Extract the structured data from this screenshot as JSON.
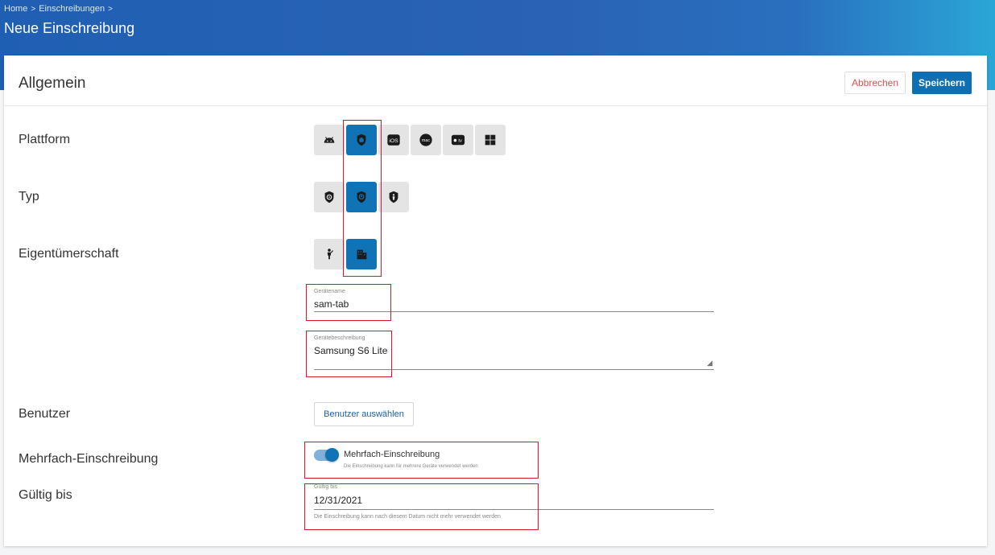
{
  "breadcrumb": {
    "home": "Home",
    "enrollments": "Einschreibungen",
    "separator": ">"
  },
  "page_title": "Neue Einschreibung",
  "card": {
    "title": "Allgemein",
    "cancel_label": "Abbrechen",
    "save_label": "Speichern"
  },
  "platform": {
    "label": "Plattform",
    "options": [
      {
        "icon": "android-icon",
        "active": false
      },
      {
        "icon": "android-enterprise-icon",
        "active": true
      },
      {
        "icon": "ios-icon",
        "text": "iOS",
        "active": false
      },
      {
        "icon": "macos-icon",
        "text": "mac",
        "active": false
      },
      {
        "icon": "apple-tv-icon",
        "text": "tv",
        "active": false
      },
      {
        "icon": "windows-icon",
        "active": false
      }
    ]
  },
  "type": {
    "label": "Typ",
    "options": [
      {
        "icon": "managed-device-icon",
        "active": false
      },
      {
        "icon": "work-profile-icon",
        "active": true
      },
      {
        "icon": "user-device-icon",
        "active": false
      }
    ]
  },
  "ownership": {
    "label": "Eigentümerschaft",
    "options": [
      {
        "icon": "personal-icon",
        "active": false
      },
      {
        "icon": "corporate-icon",
        "active": true
      }
    ]
  },
  "device_name": {
    "label": "Gerätename",
    "value": "sam-tab"
  },
  "device_description": {
    "label": "Gerätebeschreibung",
    "value": "Samsung S6 Lite"
  },
  "user": {
    "label": "Benutzer",
    "button": "Benutzer auswählen"
  },
  "multi": {
    "label": "Mehrfach-Einschreibung",
    "toggle_label": "Mehrfach-Einschreibung",
    "hint": "Die Einschreibung kann für mehrere Geräte verwendet werden",
    "enabled": true
  },
  "valid_until": {
    "label": "Gültig bis",
    "field_label": "Gültig bis",
    "value": "12/31/2021",
    "hint": "Die Einschreibung kann nach diesem Datum nicht mehr verwendet werden"
  },
  "colors": {
    "accent": "#0f73b5",
    "highlight": "#d11a2a",
    "danger": "#e05050"
  }
}
